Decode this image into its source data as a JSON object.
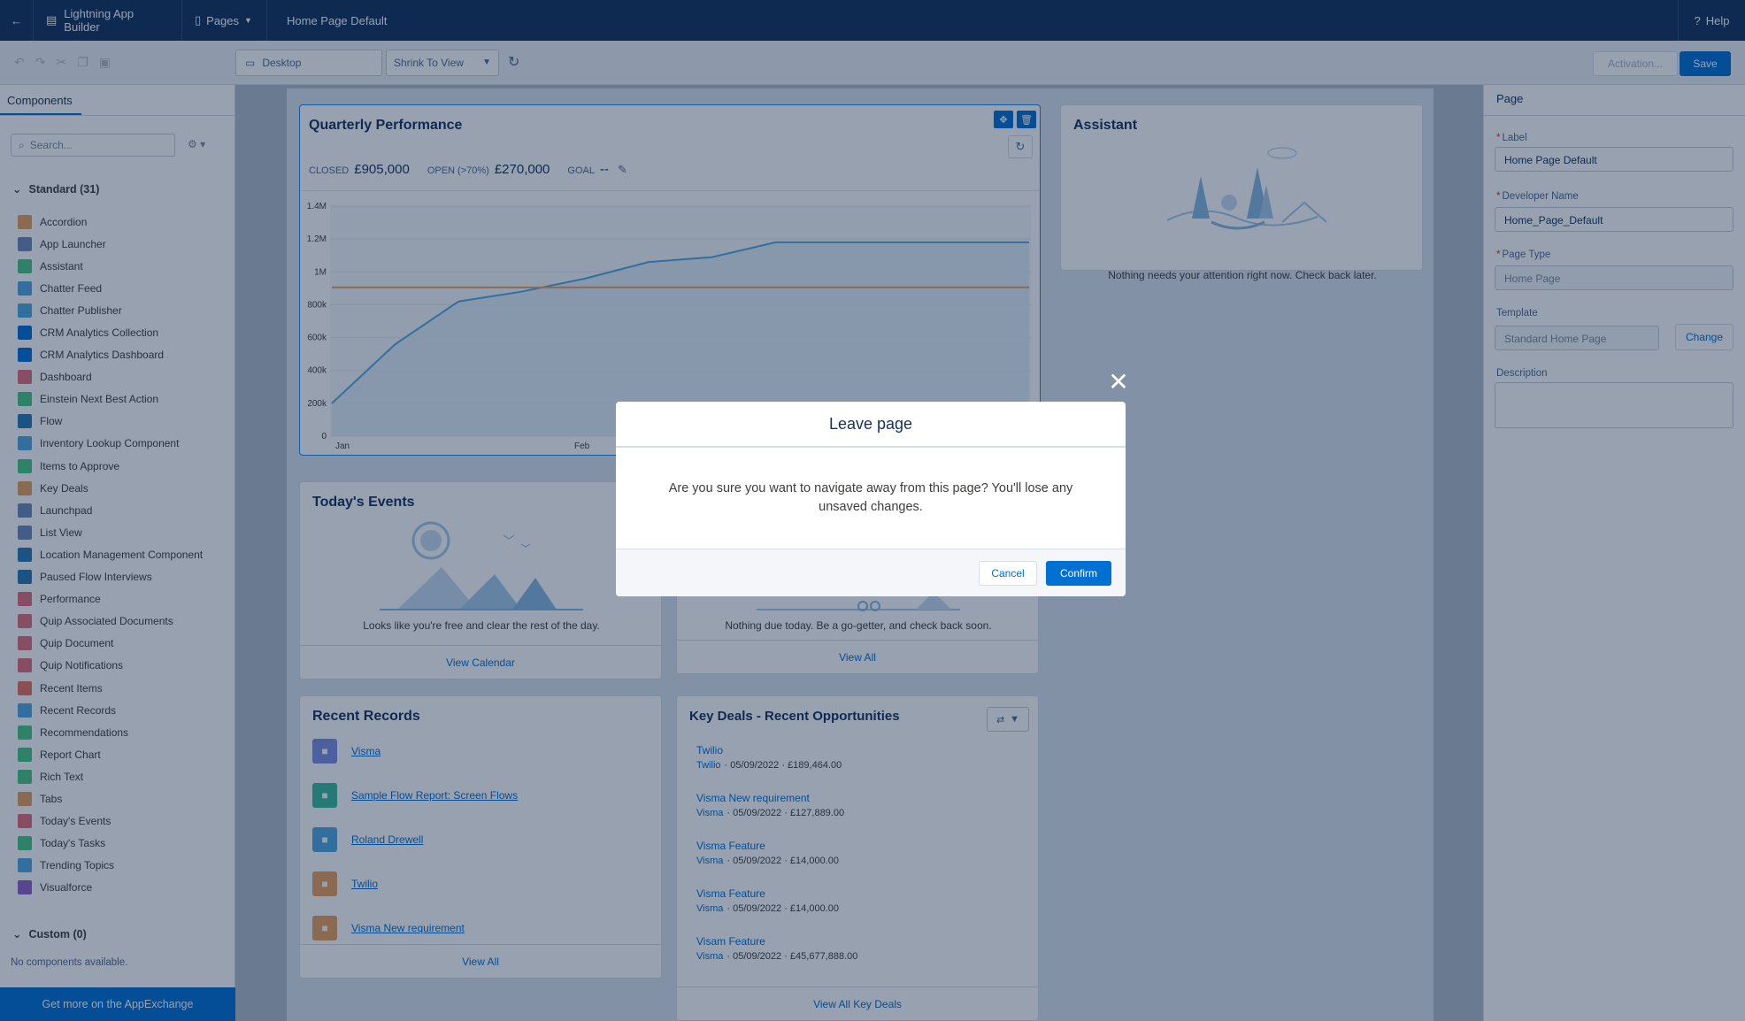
{
  "topbar": {
    "app_title": "Lightning App Builder",
    "pages_label": "Pages",
    "page_title": "Home Page Default",
    "help_label": "Help"
  },
  "toolbar": {
    "device": "Desktop",
    "zoom": "Shrink To View",
    "activation_label": "Activation...",
    "save_label": "Save"
  },
  "sidebar": {
    "tab_label": "Components",
    "search_placeholder": "Search...",
    "standard_header": "Standard (31)",
    "components": [
      {
        "label": "Accordion",
        "color": "#e8a25c"
      },
      {
        "label": "App Launcher",
        "color": "#6f8bb8"
      },
      {
        "label": "Assistant",
        "color": "#4bca81"
      },
      {
        "label": "Chatter Feed",
        "color": "#54a9e0"
      },
      {
        "label": "Chatter Publisher",
        "color": "#54a9e0"
      },
      {
        "label": "CRM Analytics Collection",
        "color": "#0070d2"
      },
      {
        "label": "CRM Analytics Dashboard",
        "color": "#0070d2"
      },
      {
        "label": "Dashboard",
        "color": "#e26e7a"
      },
      {
        "label": "Einstein Next Best Action",
        "color": "#4bca81"
      },
      {
        "label": "Flow",
        "color": "#2a7ab0"
      },
      {
        "label": "Inventory Lookup Component",
        "color": "#54a9e0"
      },
      {
        "label": "Items to Approve",
        "color": "#4bca81"
      },
      {
        "label": "Key Deals",
        "color": "#e8a25c"
      },
      {
        "label": "Launchpad",
        "color": "#6f8bb8"
      },
      {
        "label": "List View",
        "color": "#6f8bb8"
      },
      {
        "label": "Location Management Component",
        "color": "#2a7ab0"
      },
      {
        "label": "Paused Flow Interviews",
        "color": "#2a7ab0"
      },
      {
        "label": "Performance",
        "color": "#e26e7a"
      },
      {
        "label": "Quip Associated Documents",
        "color": "#e26e7a"
      },
      {
        "label": "Quip Document",
        "color": "#e26e7a"
      },
      {
        "label": "Quip Notifications",
        "color": "#e26e7a"
      },
      {
        "label": "Recent Items",
        "color": "#e87360"
      },
      {
        "label": "Recent Records",
        "color": "#54a9e0"
      },
      {
        "label": "Recommendations",
        "color": "#4bca81"
      },
      {
        "label": "Report Chart",
        "color": "#4bca81"
      },
      {
        "label": "Rich Text",
        "color": "#4bca81"
      },
      {
        "label": "Tabs",
        "color": "#e8a25c"
      },
      {
        "label": "Today's Events",
        "color": "#e26e7a"
      },
      {
        "label": "Today's Tasks",
        "color": "#4bca81"
      },
      {
        "label": "Trending Topics",
        "color": "#54a9e0"
      },
      {
        "label": "Visualforce",
        "color": "#9062c4"
      }
    ],
    "custom_header": "Custom (0)",
    "custom_empty": "No components available.",
    "appexchange_label": "Get more on the AppExchange"
  },
  "quarterly": {
    "title": "Quarterly Performance",
    "closed_label": "CLOSED",
    "closed_value": "£905,000",
    "open_label": "OPEN (>70%)",
    "open_value": "£270,000",
    "goal_label": "GOAL",
    "goal_value": "--"
  },
  "chart_data": {
    "type": "line",
    "x_ticks": [
      "Jan",
      "Feb"
    ],
    "y_ticks": [
      "0",
      "200k",
      "400k",
      "600k",
      "800k",
      "1M",
      "1.2M",
      "1.4M"
    ],
    "ylim": [
      0,
      1400000
    ],
    "series": [
      {
        "name": "Closed",
        "color": "#54a9e0",
        "values": [
          200000,
          560000,
          820000,
          880000,
          960000,
          1060000,
          1090000,
          1180000,
          1180000,
          1180000,
          1180000,
          1180000
        ]
      },
      {
        "name": "",
        "color": "#e8a25c",
        "values": [
          905000,
          905000,
          905000,
          905000,
          905000,
          905000,
          905000,
          905000,
          905000,
          905000,
          905000,
          905000
        ]
      }
    ],
    "legend": [
      "Closed"
    ]
  },
  "assistant": {
    "title": "Assistant",
    "message": "Nothing needs your attention right now. Check back later."
  },
  "events": {
    "title": "Today's Events",
    "message": "Looks like you're free and clear the rest of the day.",
    "link": "View Calendar"
  },
  "tasks": {
    "message": "Nothing due today. Be a go-getter, and check back soon.",
    "link": "View All"
  },
  "recent_records": {
    "title": "Recent Records",
    "items": [
      {
        "label": "Visma",
        "color": "#7f8de1"
      },
      {
        "label": "Sample Flow Report: Screen Flows",
        "color": "#3bba9c"
      },
      {
        "label": "Roland Drewell",
        "color": "#54a9e0"
      },
      {
        "label": "Twilio",
        "color": "#e8a25c"
      },
      {
        "label": "Visma New requirement",
        "color": "#e8a25c"
      }
    ],
    "link": "View All"
  },
  "key_deals": {
    "title": "Key Deals - Recent Opportunities",
    "deals": [
      {
        "name": "Twilio",
        "account": "Twilio",
        "meta": "· 05/09/2022 · £189,464.00"
      },
      {
        "name": "Visma New requirement",
        "account": "Visma",
        "meta": "· 05/09/2022 · £127,889.00"
      },
      {
        "name": "Visma Feature",
        "account": "Visma",
        "meta": "· 05/09/2022 · £14,000.00"
      },
      {
        "name": "Visma Feature",
        "account": "Visma",
        "meta": "· 05/09/2022 · £14,000.00"
      },
      {
        "name": "Visam Feature",
        "account": "Visma",
        "meta": "· 05/09/2022 · £45,677,888.00"
      }
    ],
    "link": "View All Key Deals"
  },
  "props": {
    "title": "Page",
    "label_label": "Label",
    "label_value": "Home Page Default",
    "devname_label": "Developer Name",
    "devname_value": "Home_Page_Default",
    "pagetype_label": "Page Type",
    "pagetype_value": "Home Page",
    "template_label": "Template",
    "template_value": "Standard Home Page",
    "change_label": "Change",
    "description_label": "Description",
    "required_mark": "*"
  },
  "modal": {
    "title": "Leave page",
    "body": "Are you sure you want to navigate away from this page? You'll lose any unsaved changes.",
    "cancel_label": "Cancel",
    "confirm_label": "Confirm"
  }
}
